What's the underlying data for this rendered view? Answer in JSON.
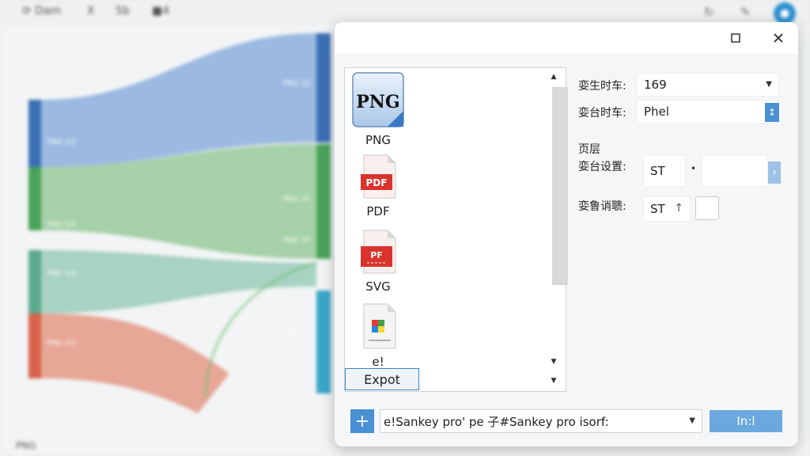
{
  "background": {
    "toolbar": {
      "item1": "⟳ Dam",
      "item2": "X",
      "item3": "5b",
      "item4": "■4"
    },
    "status": "PNG",
    "sankey_labels": [
      "PNG 1/2",
      "PNG 1/4",
      "PNG 1/4",
      "PNG 1/2",
      "PNG 33",
      "PNG 33",
      "PNG 33",
      "PNG 33"
    ]
  },
  "dialog": {
    "formats": [
      {
        "icon": "PNG",
        "label": "PNG"
      },
      {
        "icon": "PDF",
        "label": "PDF"
      },
      {
        "icon": "PF",
        "label": "SVG"
      },
      {
        "icon": "",
        "label": "e!"
      }
    ],
    "export_label": "Expot",
    "settings": {
      "row1_label": "娈生时车:",
      "row1_value": "169",
      "row2_label": "娈台时车:",
      "row2_value": "Phel",
      "section_title": "页层",
      "row3_label": "娈台设置:",
      "row3_value": "ST",
      "row4_label": "娈鲁诮聩:",
      "row4_value": "ST"
    },
    "path": "e!Sankey pro' pe 子#Sankey pro isorf:",
    "ok_label": "In:l"
  },
  "colors": {
    "accent": "#4a90d4",
    "sankey_blue": "#3b6fb6",
    "sankey_green": "#4aa35a",
    "sankey_teal": "#5aa98c",
    "sankey_red": "#d9634a"
  }
}
